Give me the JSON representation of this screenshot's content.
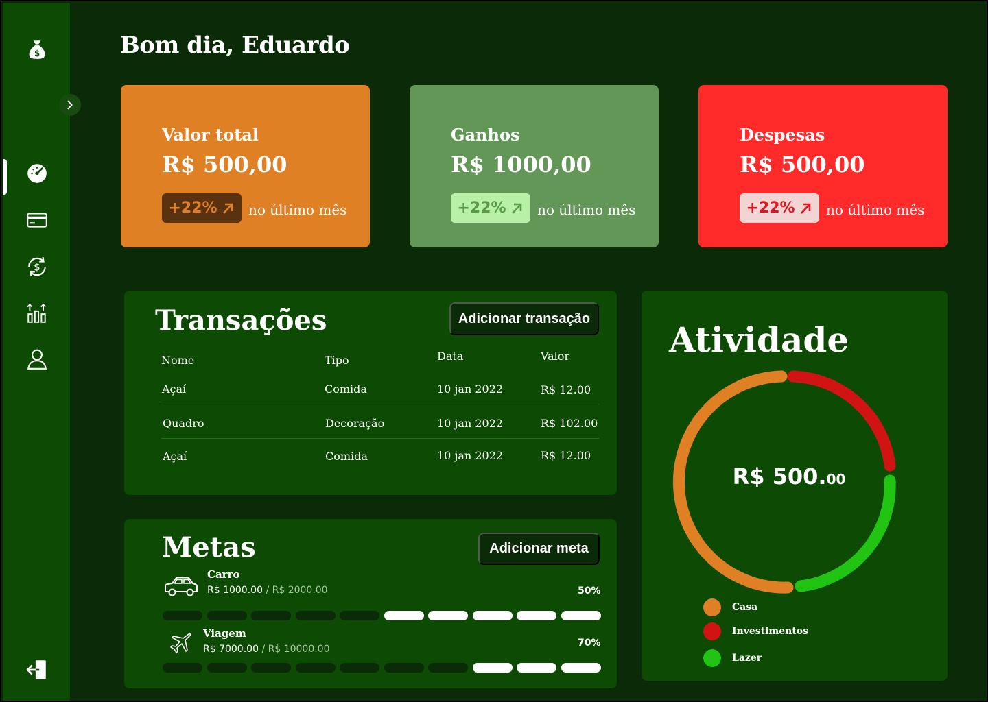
{
  "app": {
    "icons": {
      "logo": "money-bag-icon",
      "toggle": "chevron-right-icon",
      "nav": [
        "dashboard-gauge-icon",
        "credit-card-icon",
        "currency-exchange-icon",
        "chart-growth-icon",
        "user-icon"
      ],
      "logout": "logout-icon"
    }
  },
  "header": {
    "greeting": "Bom dia, Eduardo"
  },
  "stats": [
    {
      "label": "Valor total",
      "amount": "R$ 500,00",
      "change": "+22%",
      "note": "no último mês",
      "color": "#e08024"
    },
    {
      "label": "Ganhos",
      "amount": "R$ 1000,00",
      "change": "+22%",
      "note": "no último mês",
      "color": "#639758"
    },
    {
      "label": "Despesas",
      "amount": "R$ 500,00",
      "change": "+22%",
      "note": "no último mês",
      "color": "#ff2a2a"
    }
  ],
  "transactions": {
    "title": "Transações",
    "add_label": "Adicionar transação",
    "columns": [
      "Nome",
      "Tipo",
      "Data",
      "Valor"
    ],
    "rows": [
      [
        "Açaí",
        "Comida",
        "10 jan 2022",
        "R$ 12.00"
      ],
      [
        "Quadro",
        "Decoração",
        "10 jan 2022",
        "R$ 102.00"
      ],
      [
        "Açaí",
        "Comida",
        "10 jan 2022",
        "R$ 12.00"
      ]
    ]
  },
  "goals": {
    "title": "Metas",
    "add_label": "Adicionar meta",
    "items": [
      {
        "name": "Carro",
        "current": "R$ 1000.00",
        "target": "/ R$ 2000.00",
        "percent_label": "50%",
        "progress": 0.5,
        "icon": "car-icon"
      },
      {
        "name": "Viagem",
        "current": "R$ 7000.00",
        "target": "/ R$ 10000.00",
        "percent_label": "70%",
        "progress": 0.3,
        "icon": "airplane-icon"
      }
    ]
  },
  "activity": {
    "title": "Atividade",
    "total_main": "R$ 500.",
    "total_cents": "00",
    "legend": [
      {
        "label": "Casa",
        "color": "#e08024"
      },
      {
        "label": "Investimentos",
        "color": "#d01414"
      },
      {
        "label": "Lazer",
        "color": "#22c414"
      }
    ]
  }
}
